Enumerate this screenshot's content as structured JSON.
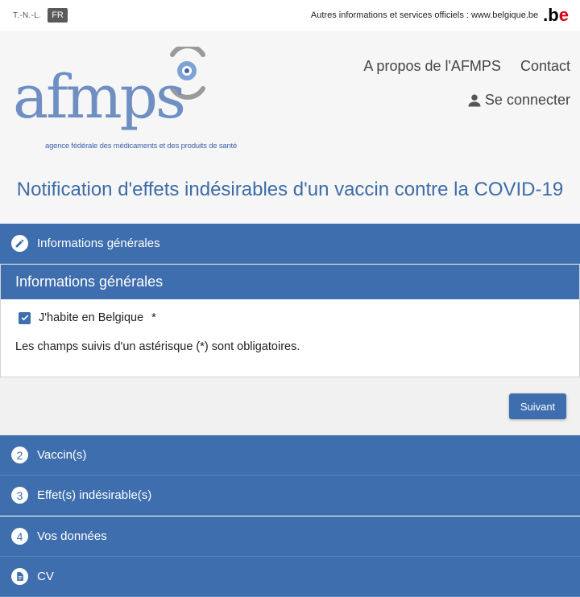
{
  "topbar": {
    "lang_other": "T.-N.-L.",
    "lang_active": "FR",
    "official_info": "Autres informations et services officiels : www.belgique.be",
    "be_logo": ".be"
  },
  "header": {
    "logo_text": "afmps",
    "logo_subtitle": "agence fédérale des médicaments et des produits de santé",
    "nav": [
      "A propos de l'AFMPS",
      "Contact"
    ],
    "login_label": "Se connecter",
    "page_title": "Notification d'effets indésirables d'un vaccin contre la COVID-19"
  },
  "steps": {
    "active": {
      "label": "Informations générales",
      "icon": "pencil-icon"
    },
    "others": [
      {
        "number": "2",
        "label": "Vaccin(s)"
      },
      {
        "number": "3",
        "label": "Effet(s) indésirable(s)"
      },
      {
        "number": "4",
        "label": "Vos données"
      },
      {
        "label": "CV",
        "icon": "document-icon"
      }
    ]
  },
  "panel": {
    "title": "Informations générales",
    "checkbox_label": "J'habite en Belgique",
    "checkbox_checked": true,
    "required_marker": "*",
    "required_note": "Les champs suivis d'un astérisque (*) sont obligatoires."
  },
  "actions": {
    "next_label": "Suivant"
  },
  "colors": {
    "accent": "#3e6ead",
    "title": "#3d6ca8",
    "logo": "#6f8fc3"
  }
}
